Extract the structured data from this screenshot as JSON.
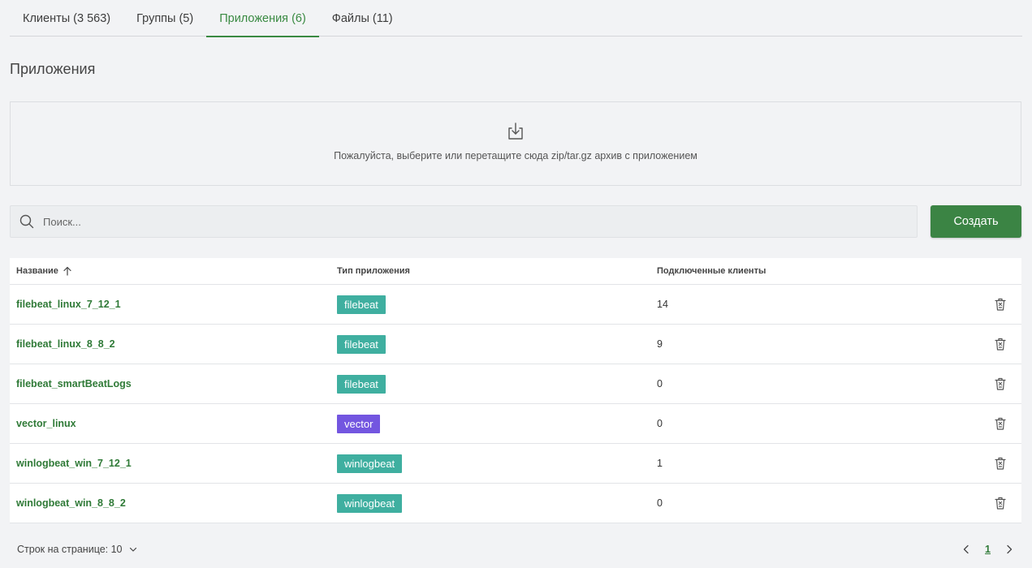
{
  "tabs": [
    {
      "label": "Клиенты (3 563)"
    },
    {
      "label": "Группы (5)"
    },
    {
      "label": "Приложения (6)",
      "active": true
    },
    {
      "label": "Файлы (11)"
    }
  ],
  "page_title": "Приложения",
  "dropzone": {
    "hint": "Пожалуйста, выберите или перетащите сюда zip/tar.gz архив с приложением",
    "icon": "upload-icon"
  },
  "search": {
    "placeholder": "Поиск...",
    "value": ""
  },
  "create_button": "Создать",
  "table": {
    "headers": {
      "name": "Название",
      "type": "Тип приложения",
      "clients": "Подключенные клиенты"
    },
    "rows": [
      {
        "name": "filebeat_linux_7_12_1",
        "type": "filebeat",
        "clients": "14"
      },
      {
        "name": "filebeat_linux_8_8_2",
        "type": "filebeat",
        "clients": "9"
      },
      {
        "name": "filebeat_smartBeatLogs",
        "type": "filebeat",
        "clients": "0"
      },
      {
        "name": "vector_linux",
        "type": "vector",
        "clients": "0"
      },
      {
        "name": "winlogbeat_win_7_12_1",
        "type": "winlogbeat",
        "clients": "1"
      },
      {
        "name": "winlogbeat_win_8_8_2",
        "type": "winlogbeat",
        "clients": "0"
      }
    ]
  },
  "badge_colors": {
    "filebeat": "#3fafa0",
    "vector": "#7356e0",
    "winlogbeat": "#3fafa0"
  },
  "colors": {
    "accent": "#3a8a42",
    "button": "#3b8444",
    "link": "#2f7a37"
  },
  "pagination": {
    "rows_per_page_label": "Строк на странице: 10",
    "current_page": "1"
  }
}
